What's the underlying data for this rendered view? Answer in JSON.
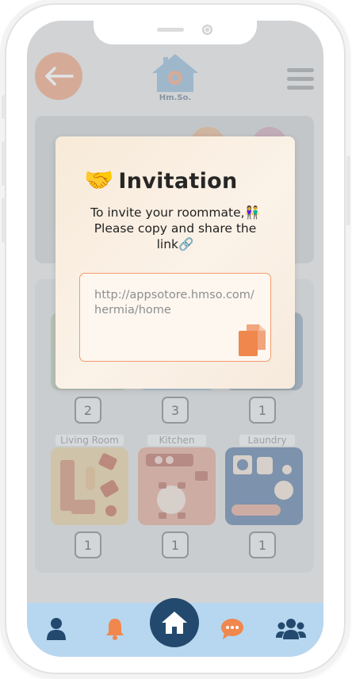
{
  "app": {
    "logo_text": "Hm.So."
  },
  "rooms": [
    {
      "label": "",
      "count": "2"
    },
    {
      "label": "",
      "count": "3"
    },
    {
      "label": "",
      "count": "1"
    },
    {
      "label": "Living Room",
      "count": "1"
    },
    {
      "label": "Kitchen",
      "count": "1"
    },
    {
      "label": "Laundry",
      "count": "1"
    }
  ],
  "modal": {
    "title_emoji": "🤝",
    "title": "Invitation",
    "message_line1": "To invite your roommate,",
    "message_emoji1": "👫",
    "message_line2": "Please copy and share the",
    "message_line3": "link",
    "message_emoji2": "🔗",
    "link_url": "http://appsotore.hmso.com/hermia/home"
  },
  "tabbar": {
    "items": [
      "profile-icon",
      "bell-icon",
      "home-icon",
      "chat-icon",
      "group-icon"
    ]
  },
  "colors": {
    "accent": "#f0874d",
    "navy": "#234a6e",
    "tabbar": "#b7d6f0"
  }
}
